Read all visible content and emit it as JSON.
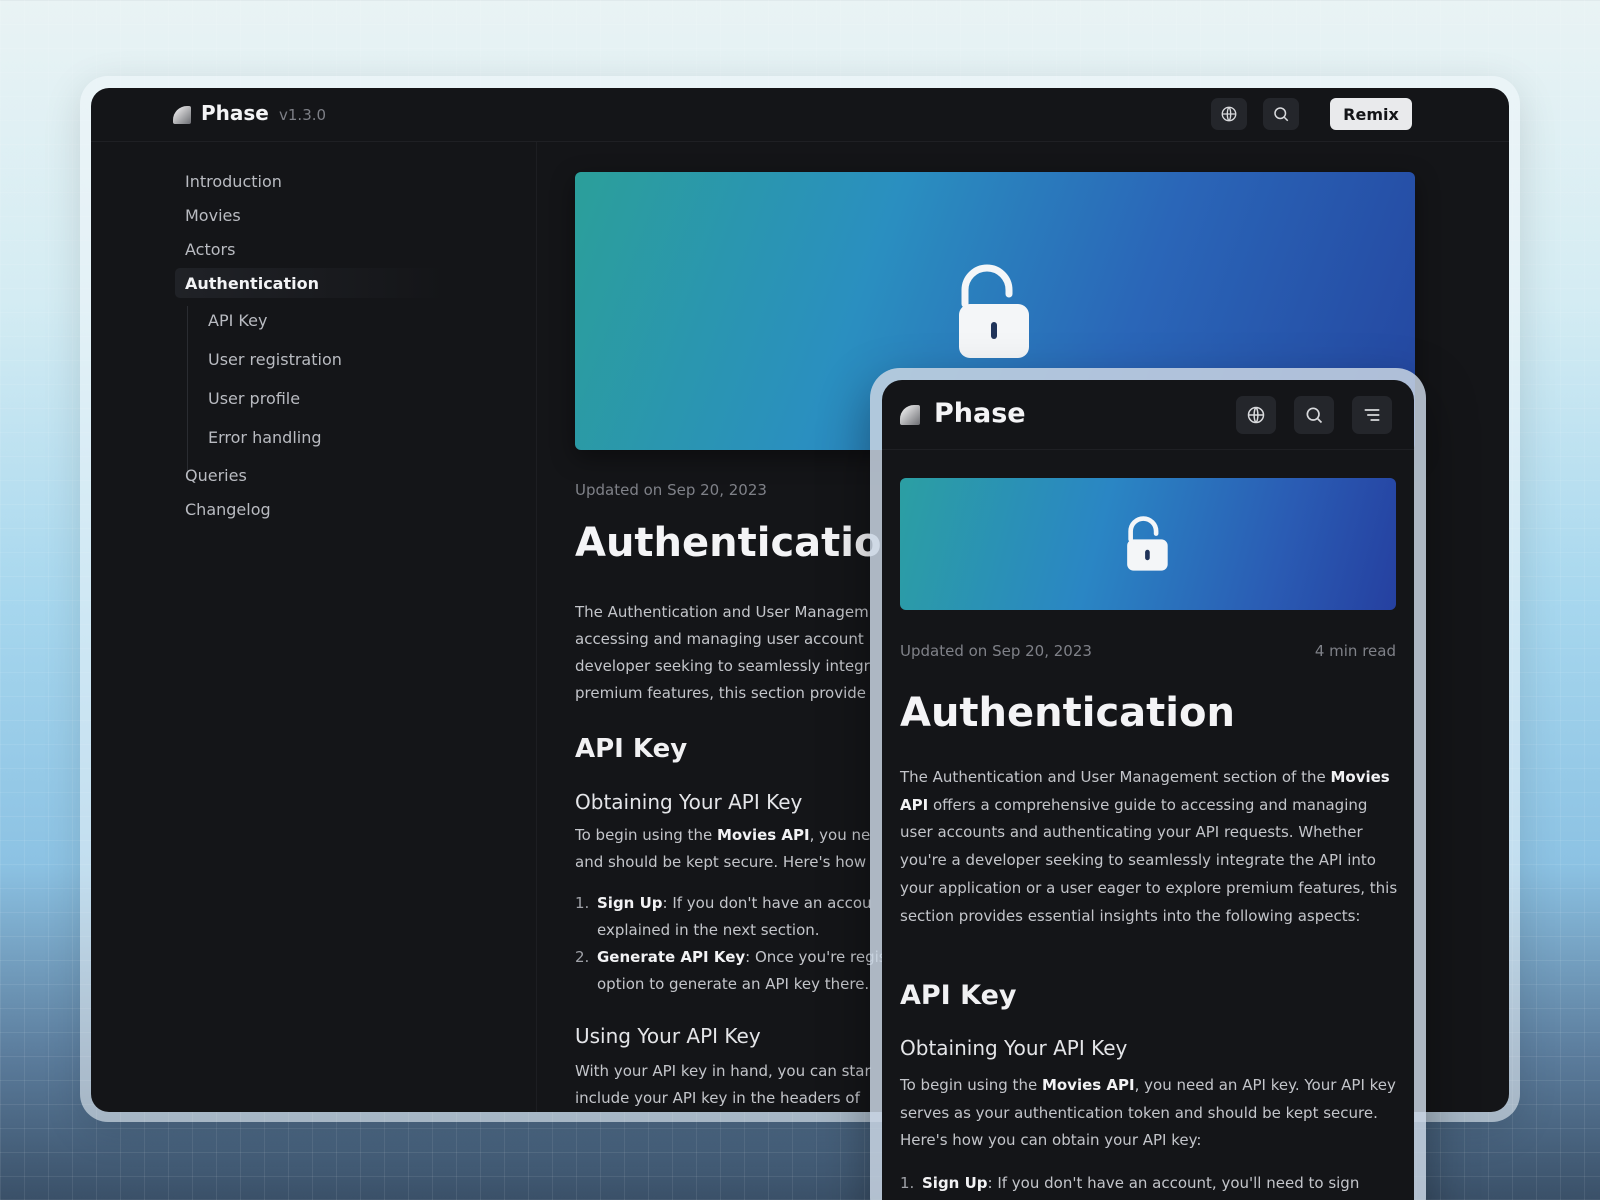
{
  "desktop": {
    "brand": "Phase",
    "version": "v1.3.0",
    "remix_label": "Remix",
    "sidebar": {
      "items": [
        {
          "label": "Introduction"
        },
        {
          "label": "Movies"
        },
        {
          "label": "Actors"
        },
        {
          "label": "Authentication",
          "active": true
        },
        {
          "label": "API Key",
          "sub": true
        },
        {
          "label": "User registration",
          "sub": true
        },
        {
          "label": "User profile",
          "sub": true
        },
        {
          "label": "Error handling",
          "sub": true
        },
        {
          "label": "Queries"
        },
        {
          "label": "Changelog"
        }
      ]
    },
    "article": {
      "updated": "Updated on Sep 20, 2023",
      "title": "Authentication",
      "intro_lines": [
        "The Authentication and User Managem",
        "accessing and managing user account",
        "developer seeking to seamlessly integr",
        "premium features, this section provide"
      ],
      "h2": "API Key",
      "h3_obtain": "Obtaining Your API Key",
      "obtain_pre": "To begin using the ",
      "obtain_bold": "Movies API",
      "obtain_post": ", you ne",
      "obtain_line2": "and should be kept secure. Here's how",
      "list": [
        {
          "num": "1.",
          "bold": "Sign Up",
          "rest": ": If you don't have an accou",
          "line2": "explained in the next section."
        },
        {
          "num": "2.",
          "bold": "Generate API Key",
          "rest": ": Once you're regis",
          "line2": "option to generate an API key there."
        }
      ],
      "h3_using": "Using Your API Key",
      "using_line1": "With your API key in hand, you can star",
      "using_line2": "include your API key in the headers of"
    }
  },
  "mobile": {
    "brand": "Phase",
    "updated": "Updated on Sep 20, 2023",
    "read_time": "4 min read",
    "title": "Authentication",
    "intro_pre": "The Authentication and User Management section of the ",
    "intro_bold": "Movies API",
    "intro_post": " offers a comprehensive guide to accessing and managing user accounts and authenticating your API requests. Whether you're a developer seeking to seamlessly integrate the API into your application or a user eager to explore premium features, this section provides essential insights into the following aspects:",
    "h2": "API Key",
    "h3": "Obtaining Your API Key",
    "obtain_pre": "To begin using the ",
    "obtain_bold": "Movies API",
    "obtain_post": ", you need an API key. Your API key serves as your authentication token and should be kept secure. Here's how you can obtain your API key:",
    "list1_num": "1.",
    "list1_bold": "Sign Up",
    "list1_rest": ": If you don't have an account, you'll need to sign"
  },
  "icons": {
    "globe": "globe-icon",
    "search": "search-icon",
    "menu": "menu-icon",
    "lock": "unlock-icon",
    "logo": "phase-logo-icon"
  },
  "colors": {
    "background_dark": "#141518",
    "hero_start": "#2b9f9a",
    "hero_end": "#2446a0",
    "remix_button": "#e9eaec"
  }
}
